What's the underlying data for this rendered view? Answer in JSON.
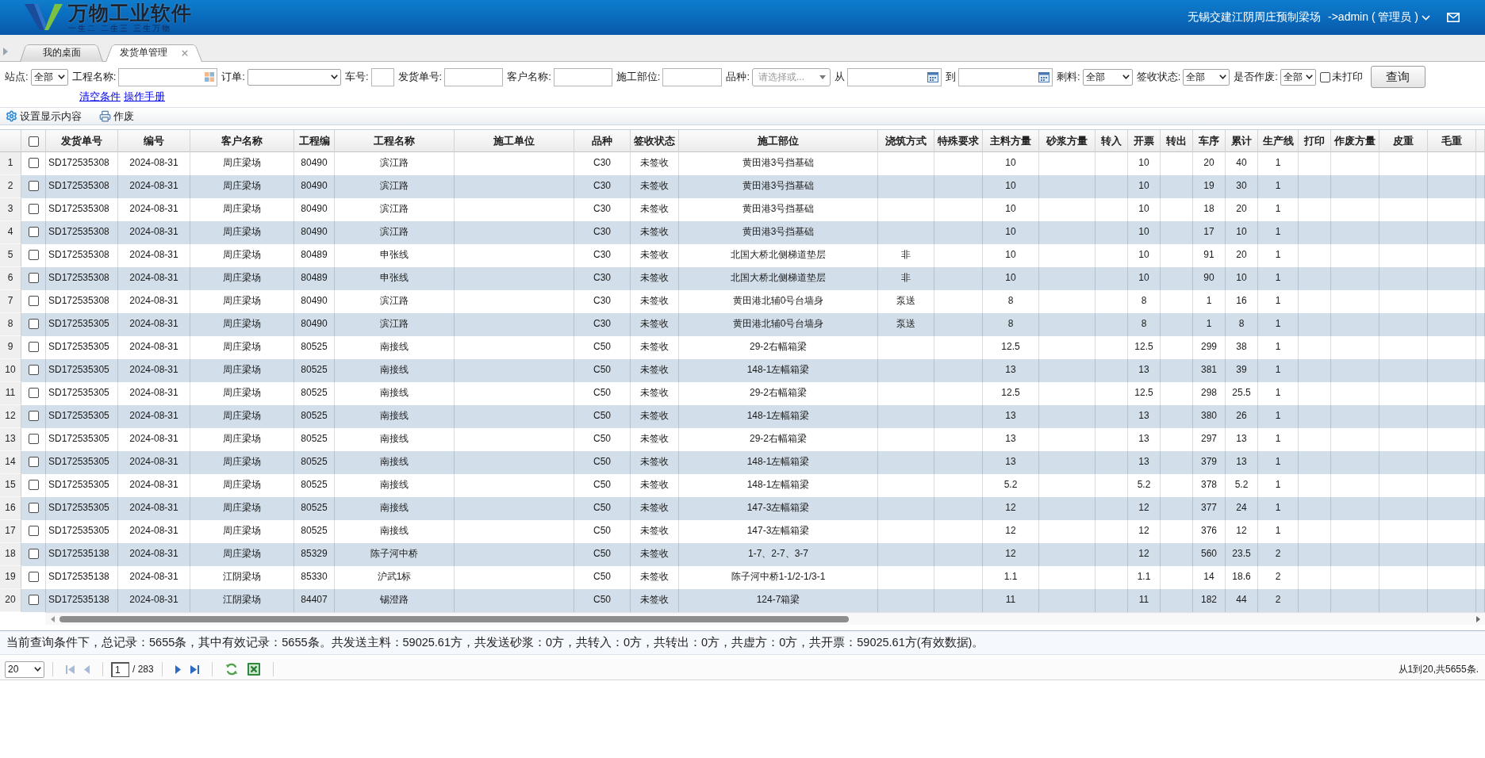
{
  "header": {
    "brand": "万物工业软件",
    "slogan": "一生二 二生三 三生万物",
    "organization": "无锡交建江阴周庄预制梁场",
    "user": "->admin ( 管理员 )"
  },
  "tabs": [
    {
      "label": "我的桌面",
      "selected": false,
      "closable": false
    },
    {
      "label": "发货单管理",
      "selected": true,
      "closable": true
    }
  ],
  "filters": [
    {
      "kind": "select",
      "label": "站点:",
      "value": "全部"
    },
    {
      "kind": "lookup",
      "label": "工程名称:"
    },
    {
      "kind": "select",
      "label": "订单:"
    },
    {
      "kind": "text",
      "label": "车号:"
    },
    {
      "kind": "text",
      "label": "发货单号:"
    },
    {
      "kind": "text",
      "label": "客户名称:"
    },
    {
      "kind": "text",
      "label": "施工部位:"
    },
    {
      "kind": "combo",
      "label": "品种:",
      "placeholder": "请选择或..."
    },
    {
      "kind": "date",
      "label": "从"
    },
    {
      "kind": "date",
      "label": "到"
    },
    {
      "kind": "select",
      "label": "剩料:",
      "value": "全部"
    },
    {
      "kind": "select",
      "label": "签收状态:",
      "value": "全部"
    },
    {
      "kind": "select",
      "label": "是否作废:",
      "value": "全部"
    },
    {
      "kind": "checkbox",
      "label": "未打印",
      "checked": false
    }
  ],
  "search_button": "查询",
  "links": [
    "清空条件",
    "操作手册"
  ],
  "toolbar": [
    {
      "kind": "settings",
      "label": "设置显示内容"
    },
    {
      "kind": "print",
      "label": "作废"
    }
  ],
  "table": {
    "select_all_checked": false,
    "columns": [
      "发货单号",
      "编号",
      "客户名称",
      "工程编",
      "工程名称",
      "施工单位",
      "品种",
      "签收状态",
      "施工部位",
      "浇筑方式",
      "特殊要求",
      "主料方量",
      "砂浆方量",
      "转入",
      "开票",
      "转出",
      "车序",
      "累计",
      "生产线",
      "打印",
      "作废方量",
      "皮重",
      "毛重"
    ],
    "rows": [
      {
        "row_no": "1",
        "checked": false,
        "shipment_no": "SD172535308",
        "serial": "2024-08-31",
        "customer": "周庄梁场",
        "project_code": "80490",
        "project_name": "滨江路",
        "grade": "C30",
        "sign_status": "未签收",
        "site_part": "黄田港3号挡基础",
        "main_volume": "10",
        "invoice": "10",
        "truck_seq": "20",
        "cumulative": "40",
        "production_line": "1"
      },
      {
        "row_no": "2",
        "checked": false,
        "shipment_no": "SD172535308",
        "serial": "2024-08-31",
        "customer": "周庄梁场",
        "project_code": "80490",
        "project_name": "滨江路",
        "grade": "C30",
        "sign_status": "未签收",
        "site_part": "黄田港3号挡基础",
        "main_volume": "10",
        "invoice": "10",
        "truck_seq": "19",
        "cumulative": "30",
        "production_line": "1"
      },
      {
        "row_no": "3",
        "checked": false,
        "shipment_no": "SD172535308",
        "serial": "2024-08-31",
        "customer": "周庄梁场",
        "project_code": "80490",
        "project_name": "滨江路",
        "grade": "C30",
        "sign_status": "未签收",
        "site_part": "黄田港3号挡基础",
        "main_volume": "10",
        "invoice": "10",
        "truck_seq": "18",
        "cumulative": "20",
        "production_line": "1"
      },
      {
        "row_no": "4",
        "checked": false,
        "shipment_no": "SD172535308",
        "serial": "2024-08-31",
        "customer": "周庄梁场",
        "project_code": "80490",
        "project_name": "滨江路",
        "grade": "C30",
        "sign_status": "未签收",
        "site_part": "黄田港3号挡基础",
        "main_volume": "10",
        "invoice": "10",
        "truck_seq": "17",
        "cumulative": "10",
        "production_line": "1"
      },
      {
        "row_no": "5",
        "checked": false,
        "shipment_no": "SD172535308",
        "serial": "2024-08-31",
        "customer": "周庄梁场",
        "project_code": "80489",
        "project_name": "申张线",
        "grade": "C30",
        "sign_status": "未签收",
        "site_part": "北国大桥北侧梯道垫层",
        "pour_method": "非",
        "main_volume": "10",
        "invoice": "10",
        "truck_seq": "91",
        "cumulative": "20",
        "production_line": "1"
      },
      {
        "row_no": "6",
        "checked": false,
        "shipment_no": "SD172535308",
        "serial": "2024-08-31",
        "customer": "周庄梁场",
        "project_code": "80489",
        "project_name": "申张线",
        "grade": "C30",
        "sign_status": "未签收",
        "site_part": "北国大桥北侧梯道垫层",
        "pour_method": "非",
        "main_volume": "10",
        "invoice": "10",
        "truck_seq": "90",
        "cumulative": "10",
        "production_line": "1"
      },
      {
        "row_no": "7",
        "checked": false,
        "shipment_no": "SD172535308",
        "serial": "2024-08-31",
        "customer": "周庄梁场",
        "project_code": "80490",
        "project_name": "滨江路",
        "grade": "C30",
        "sign_status": "未签收",
        "site_part": "黄田港北辅0号台墙身",
        "pour_method": "泵送",
        "main_volume": "8",
        "invoice": "8",
        "truck_seq": "1",
        "cumulative": "16",
        "production_line": "1"
      },
      {
        "row_no": "8",
        "checked": false,
        "shipment_no": "SD172535305",
        "serial": "2024-08-31",
        "customer": "周庄梁场",
        "project_code": "80490",
        "project_name": "滨江路",
        "grade": "C30",
        "sign_status": "未签收",
        "site_part": "黄田港北辅0号台墙身",
        "pour_method": "泵送",
        "main_volume": "8",
        "invoice": "8",
        "truck_seq": "1",
        "cumulative": "8",
        "production_line": "1"
      },
      {
        "row_no": "9",
        "checked": false,
        "shipment_no": "SD172535305",
        "serial": "2024-08-31",
        "customer": "周庄梁场",
        "project_code": "80525",
        "project_name": "南接线",
        "grade": "C50",
        "sign_status": "未签收",
        "site_part": "29-2右幅箱梁",
        "main_volume": "12.5",
        "invoice": "12.5",
        "truck_seq": "299",
        "cumulative": "38",
        "production_line": "1"
      },
      {
        "row_no": "10",
        "checked": false,
        "shipment_no": "SD172535305",
        "serial": "2024-08-31",
        "customer": "周庄梁场",
        "project_code": "80525",
        "project_name": "南接线",
        "grade": "C50",
        "sign_status": "未签收",
        "site_part": "148-1左幅箱梁",
        "main_volume": "13",
        "invoice": "13",
        "truck_seq": "381",
        "cumulative": "39",
        "production_line": "1"
      },
      {
        "row_no": "11",
        "checked": false,
        "shipment_no": "SD172535305",
        "serial": "2024-08-31",
        "customer": "周庄梁场",
        "project_code": "80525",
        "project_name": "南接线",
        "grade": "C50",
        "sign_status": "未签收",
        "site_part": "29-2右幅箱梁",
        "main_volume": "12.5",
        "invoice": "12.5",
        "truck_seq": "298",
        "cumulative": "25.5",
        "production_line": "1"
      },
      {
        "row_no": "12",
        "checked": false,
        "shipment_no": "SD172535305",
        "serial": "2024-08-31",
        "customer": "周庄梁场",
        "project_code": "80525",
        "project_name": "南接线",
        "grade": "C50",
        "sign_status": "未签收",
        "site_part": "148-1左幅箱梁",
        "main_volume": "13",
        "invoice": "13",
        "truck_seq": "380",
        "cumulative": "26",
        "production_line": "1"
      },
      {
        "row_no": "13",
        "checked": false,
        "shipment_no": "SD172535305",
        "serial": "2024-08-31",
        "customer": "周庄梁场",
        "project_code": "80525",
        "project_name": "南接线",
        "grade": "C50",
        "sign_status": "未签收",
        "site_part": "29-2右幅箱梁",
        "main_volume": "13",
        "invoice": "13",
        "truck_seq": "297",
        "cumulative": "13",
        "production_line": "1"
      },
      {
        "row_no": "14",
        "checked": false,
        "shipment_no": "SD172535305",
        "serial": "2024-08-31",
        "customer": "周庄梁场",
        "project_code": "80525",
        "project_name": "南接线",
        "grade": "C50",
        "sign_status": "未签收",
        "site_part": "148-1左幅箱梁",
        "main_volume": "13",
        "invoice": "13",
        "truck_seq": "379",
        "cumulative": "13",
        "production_line": "1"
      },
      {
        "row_no": "15",
        "checked": false,
        "shipment_no": "SD172535305",
        "serial": "2024-08-31",
        "customer": "周庄梁场",
        "project_code": "80525",
        "project_name": "南接线",
        "grade": "C50",
        "sign_status": "未签收",
        "site_part": "148-1左幅箱梁",
        "main_volume": "5.2",
        "invoice": "5.2",
        "truck_seq": "378",
        "cumulative": "5.2",
        "production_line": "1"
      },
      {
        "row_no": "16",
        "checked": false,
        "shipment_no": "SD172535305",
        "serial": "2024-08-31",
        "customer": "周庄梁场",
        "project_code": "80525",
        "project_name": "南接线",
        "grade": "C50",
        "sign_status": "未签收",
        "site_part": "147-3左幅箱梁",
        "main_volume": "12",
        "invoice": "12",
        "truck_seq": "377",
        "cumulative": "24",
        "production_line": "1"
      },
      {
        "row_no": "17",
        "checked": false,
        "shipment_no": "SD172535305",
        "serial": "2024-08-31",
        "customer": "周庄梁场",
        "project_code": "80525",
        "project_name": "南接线",
        "grade": "C50",
        "sign_status": "未签收",
        "site_part": "147-3左幅箱梁",
        "main_volume": "12",
        "invoice": "12",
        "truck_seq": "376",
        "cumulative": "12",
        "production_line": "1"
      },
      {
        "row_no": "18",
        "checked": false,
        "shipment_no": "SD172535138",
        "serial": "2024-08-31",
        "customer": "周庄梁场",
        "project_code": "85329",
        "project_name": "陈子河中桥",
        "grade": "C50",
        "sign_status": "未签收",
        "site_part": "1-7、2-7、3-7",
        "main_volume": "12",
        "invoice": "12",
        "truck_seq": "560",
        "cumulative": "23.5",
        "production_line": "2"
      },
      {
        "row_no": "19",
        "checked": false,
        "shipment_no": "SD172535138",
        "serial": "2024-08-31",
        "customer": "江阴梁场",
        "project_code": "85330",
        "project_name": "沪武1标",
        "grade": "C50",
        "sign_status": "未签收",
        "site_part": "陈子河中桥1-1/2-1/3-1",
        "main_volume": "1.1",
        "invoice": "1.1",
        "truck_seq": "14",
        "cumulative": "18.6",
        "production_line": "2"
      },
      {
        "row_no": "20",
        "checked": false,
        "shipment_no": "SD172535138",
        "serial": "2024-08-31",
        "customer": "江阴梁场",
        "project_code": "84407",
        "project_name": "锡澄路",
        "grade": "C50",
        "sign_status": "未签收",
        "site_part": "124-7箱梁",
        "main_volume": "11",
        "invoice": "11",
        "truck_seq": "182",
        "cumulative": "44",
        "production_line": "2"
      }
    ]
  },
  "status_text": "当前查询条件下，总记录：5655条，其中有效记录：5655条。共发送主料：59025.61方，共发送砂浆：0方，共转入：0方，共转出：0方，共虚方：0方，共开票：59025.61方(有效数据)。",
  "pagination": {
    "page_size": "20",
    "nav_back": [
      {
        "kind": "first",
        "disabled": true
      },
      {
        "kind": "prev",
        "disabled": true
      }
    ],
    "page": "1",
    "total_pages": "/ 283",
    "nav_forward": [
      {
        "kind": "next",
        "disabled": false
      },
      {
        "kind": "last",
        "disabled": false
      }
    ],
    "tools": [
      {
        "kind": "refresh"
      },
      {
        "kind": "excel"
      }
    ],
    "summary": "从1到20,共5655条."
  }
}
